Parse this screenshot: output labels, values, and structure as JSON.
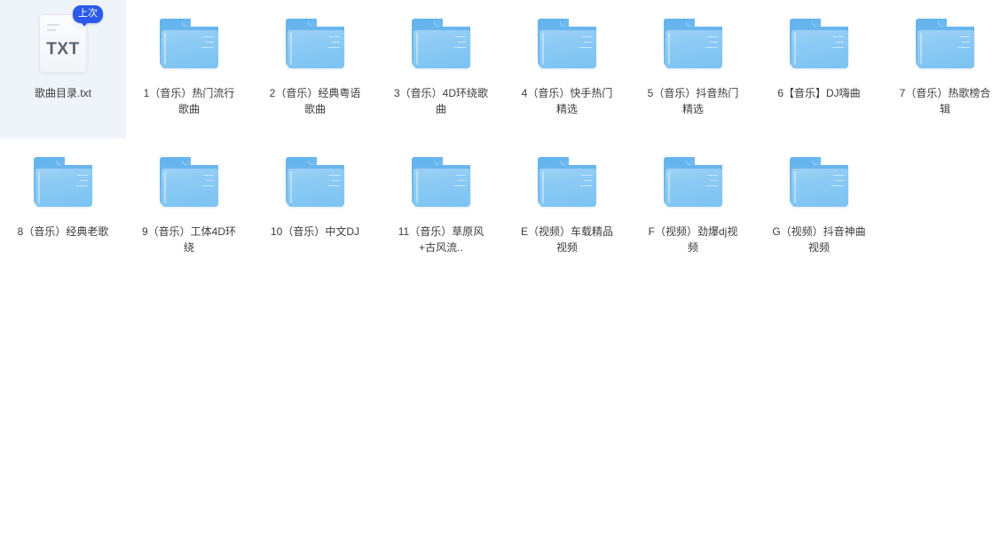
{
  "view": {
    "background_color": "#ffffff",
    "highlight_color": "#eff4fb",
    "folder_color": "#7cc3f2",
    "badge_color": "#2b59e8",
    "label_color": "#3c3c3c"
  },
  "items": [
    {
      "type": "file",
      "icon": "txt-file-icon",
      "icon_text": "TXT",
      "name": "歌曲目录.txt",
      "badge": "上次",
      "highlighted": true
    },
    {
      "type": "folder",
      "icon": "folder-icon",
      "name": "1（音乐）热门流行歌曲",
      "badge": null,
      "highlighted": false
    },
    {
      "type": "folder",
      "icon": "folder-icon",
      "name": "2（音乐）经典粤语歌曲",
      "badge": null,
      "highlighted": false
    },
    {
      "type": "folder",
      "icon": "folder-icon",
      "name": "3（音乐）4D环绕歌曲",
      "badge": null,
      "highlighted": false
    },
    {
      "type": "folder",
      "icon": "folder-icon",
      "name": "4（音乐）快手热门精选",
      "badge": null,
      "highlighted": false
    },
    {
      "type": "folder",
      "icon": "folder-icon",
      "name": "5（音乐）抖音热门精选",
      "badge": null,
      "highlighted": false
    },
    {
      "type": "folder",
      "icon": "folder-icon",
      "name": "6【音乐】DJ嗨曲",
      "badge": null,
      "highlighted": false
    },
    {
      "type": "folder",
      "icon": "folder-icon",
      "name": "7（音乐）热歌榜合辑",
      "badge": null,
      "highlighted": false
    },
    {
      "type": "folder",
      "icon": "folder-icon",
      "name": "8（音乐）经典老歌",
      "badge": null,
      "highlighted": false
    },
    {
      "type": "folder",
      "icon": "folder-icon",
      "name": "9（音乐）工体4D环绕",
      "badge": null,
      "highlighted": false
    },
    {
      "type": "folder",
      "icon": "folder-icon",
      "name": "10（音乐）中文DJ",
      "badge": null,
      "highlighted": false
    },
    {
      "type": "folder",
      "icon": "folder-icon",
      "name": "11（音乐）草原风+古风流..",
      "badge": null,
      "highlighted": false
    },
    {
      "type": "folder",
      "icon": "folder-icon",
      "name": "E（视频）车载精品视频",
      "badge": null,
      "highlighted": false
    },
    {
      "type": "folder",
      "icon": "folder-icon",
      "name": "F（视频）劲爆dj视频",
      "badge": null,
      "highlighted": false
    },
    {
      "type": "folder",
      "icon": "folder-icon",
      "name": "G（视频）抖音神曲视频",
      "badge": null,
      "highlighted": false
    }
  ]
}
